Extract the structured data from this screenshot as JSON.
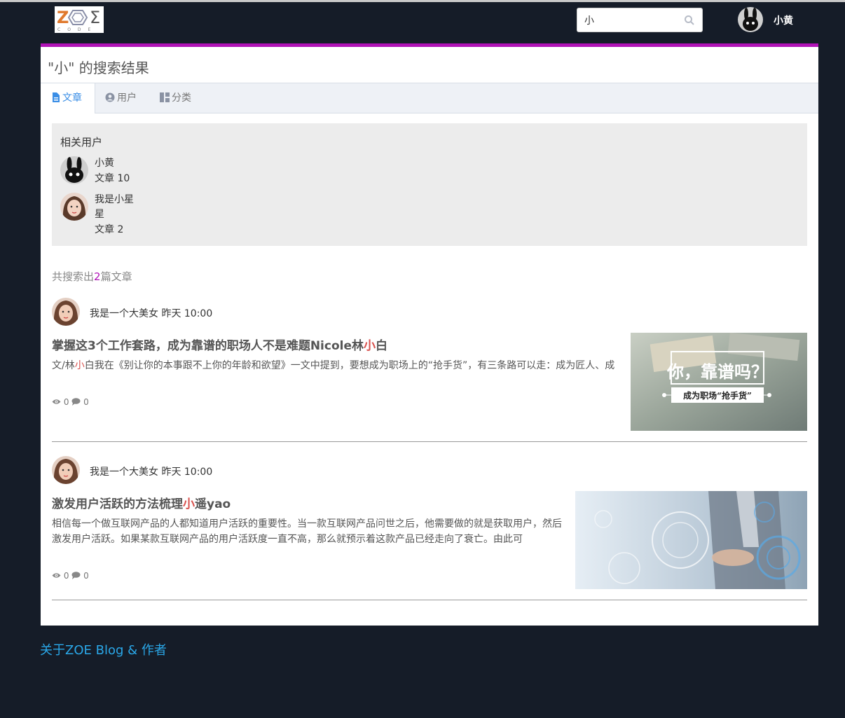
{
  "header": {
    "logo_text": "ZOE CODE",
    "search_value": "小",
    "username": "小黄"
  },
  "page": {
    "title": "\"小\" 的搜索结果"
  },
  "tabs": [
    {
      "label": "文章",
      "icon": "file-icon",
      "active": true
    },
    {
      "label": "用户",
      "icon": "user-circle-icon",
      "active": false
    },
    {
      "label": "分类",
      "icon": "columns-icon",
      "active": false
    }
  ],
  "related_users": {
    "heading": "相关用户",
    "items": [
      {
        "name": "小黄",
        "articles": "文章 10",
        "avatar": "bunny-avatar"
      },
      {
        "name": "我是小星星",
        "articles": "文章 2",
        "avatar": "girl-avatar"
      }
    ]
  },
  "result_count": {
    "prefix": "共搜索出",
    "number": "2",
    "suffix": "篇文章"
  },
  "posts": [
    {
      "author": "我是一个大美女",
      "time": "昨天 10:00",
      "title_before": "掌握这3个工作套路，成为靠谱的职场人不是难题Nicole林",
      "title_highlight": "小",
      "title_after": "白",
      "excerpt_before": "文/林",
      "excerpt_highlight": "小",
      "excerpt_after": "白我在《别让你的本事跟不上你的年龄和欲望》一文中提到，要想成为职场上的“抢手货”，有三条路可以走：成为匠人、成",
      "views": "0",
      "comments": "0",
      "thumb_text_main": "你，靠谱吗？",
      "thumb_text_sub": "成为职场“抢手货”"
    },
    {
      "author": "我是一个大美女",
      "time": "昨天 10:00",
      "title_before": "激发用户活跃的方法梳理",
      "title_highlight": "小",
      "title_after": "遥yao",
      "excerpt_before": "相信每一个做互联网产品的人都知道用户活跃的重要性。当一款互联网产品问世之后，他需要做的就是获取用户，然后激发用户活跃。如果某款互联网产品的用户活跃度一直不高，那么就预示着这款产品已经走向了衰亡。由此可",
      "excerpt_highlight": "",
      "excerpt_after": "",
      "views": "0",
      "comments": "0"
    }
  ],
  "footer": {
    "link": "关于ZOE Blog & 作者"
  },
  "colors": {
    "background": "#151c28",
    "accent": "#b012b6",
    "highlight": "#d9534f",
    "tab_active": "#3a8ee6",
    "footer_link": "#2aa7e8"
  }
}
